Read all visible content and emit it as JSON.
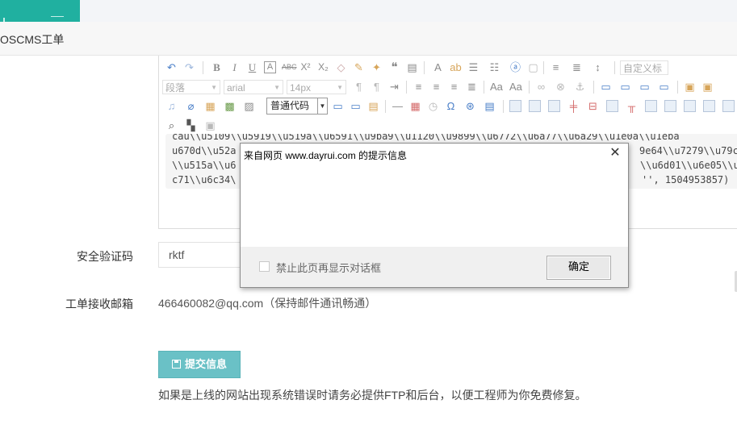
{
  "app": {
    "header_title": "OSCMS工单"
  },
  "editor": {
    "toolbar": {
      "paragraph_select": "段落",
      "font_select": "arial",
      "size_select": "14px",
      "code_select": "普通代码",
      "custom_select": "自定义标"
    },
    "content_lines": [
      "cau\\\\u5109\\\\u5919\\\\u519a\\\\u6591\\\\u9ba9\\\\u1120\\\\u9899\\\\u6772\\\\u6a77\\\\u6a29\\\\u1e0a\\\\u1eba",
      "u670d\\\\u52a",
      "\\\\u515a\\\\u6",
      "c71\\\\u6c34\\"
    ],
    "content_tail_right": [
      "9e64\\\\u7279\\\\u79c",
      "\\\\u6d01\\\\u6e05\\\\u",
      "'', 1504953857)"
    ]
  },
  "form": {
    "captcha_label": "安全验证码",
    "captcha_value": "rktf",
    "email_label": "工单接收邮箱",
    "email_value": "466460082@qq.com（保持邮件通讯畅通）",
    "submit_label": "提交信息",
    "note": "如果是上线的网站出现系统错误时请务必提供FTP和后台，以便工程师为你免费修复。"
  },
  "dialog": {
    "title": "来自网页 www.dayrui.com 的提示信息",
    "close_symbol": "✕",
    "checkbox_label": "禁止此页再显示对话框",
    "ok_label": "确定"
  }
}
